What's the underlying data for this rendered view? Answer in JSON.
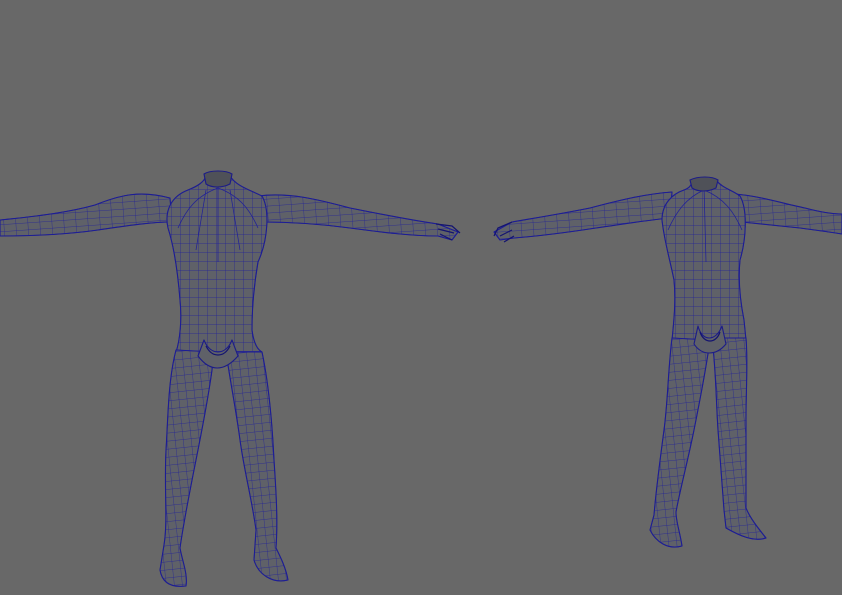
{
  "viewport": {
    "background": "#686868",
    "mesh_fill": "#5f6168",
    "wire_color": "#1e1e9a"
  },
  "models": [
    {
      "view": "front",
      "pose": "T-pose",
      "headless": true
    },
    {
      "view": "three-quarter",
      "pose": "T-pose",
      "headless": true
    }
  ]
}
